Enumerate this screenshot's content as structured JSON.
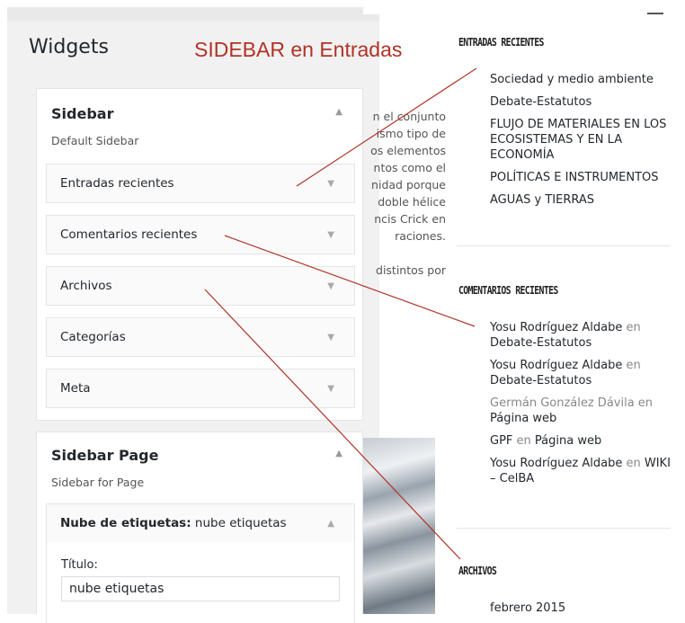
{
  "admin": {
    "title": "Widgets",
    "annotation": "SIDEBAR en Entradas",
    "sidebar_panel": {
      "title": "Sidebar",
      "subtitle": "Default Sidebar",
      "widgets": [
        {
          "label": "Entradas recientes"
        },
        {
          "label": "Comentarios recientes"
        },
        {
          "label": "Archivos"
        },
        {
          "label": "Categorías"
        },
        {
          "label": "Meta"
        }
      ]
    },
    "page_panel": {
      "title": "Sidebar Page",
      "subtitle": "Sidebar for Page",
      "widget_label_bold": "Nube de etiquetas:",
      "widget_label_rest": " nube etiquetas",
      "titulo_label": "Título:",
      "titulo_value": "nube etiquetas"
    }
  },
  "preview": {
    "lines": [
      "n el conjunto",
      "ismo tipo de",
      "os elementos",
      "ntos como el",
      "nidad porque",
      "doble hélice",
      "ncis Crick en",
      "raciones.",
      "",
      "distintos por"
    ]
  },
  "front": {
    "recent_posts": {
      "heading": "ENTRADAS RECIENTES",
      "items": [
        "Sociedad y medio ambiente",
        "Debate-Estatutos",
        "FLUJO DE MATERIALES EN LOS ECOSISTEMAS Y EN LA ECONOMÍA",
        "POLÍTICAS E INSTRUMENTOS",
        "AGUAS y TIERRAS"
      ]
    },
    "recent_comments": {
      "heading": "COMENTARIOS RECIENTES",
      "items": [
        {
          "author": "Yosu Rodríguez Aldabe",
          "en": " en ",
          "post": "Debate-Estatutos"
        },
        {
          "author": "Yosu Rodríguez Aldabe",
          "en": " en ",
          "post": "Debate-Estatutos"
        },
        {
          "author": "Germán González Dávila",
          "en": " en ",
          "post": "Página web"
        },
        {
          "author": "GPF",
          "en": " en ",
          "post": "Página web"
        },
        {
          "author": "Yosu Rodríguez Aldabe",
          "en": " en ",
          "post": "WIKI – CelBA"
        }
      ]
    },
    "archives": {
      "heading": "ARCHIVOS",
      "items": [
        "febrero 2015"
      ]
    }
  },
  "colors": {
    "annotation": "#b03327",
    "admin_bg": "#f1f1f1"
  }
}
